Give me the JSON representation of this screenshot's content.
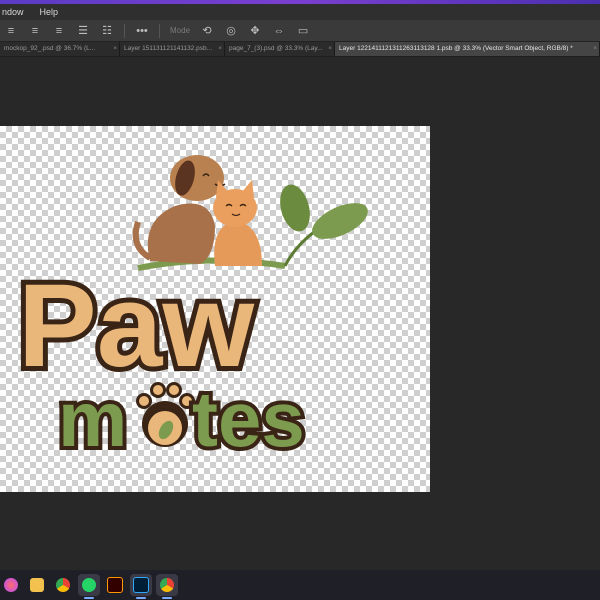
{
  "menu": {
    "items": [
      "ndow",
      "Help"
    ]
  },
  "options_bar": {
    "mode_label": "Mode"
  },
  "tabs": [
    {
      "label": "mockop_92_.psd @ 36.7% (L...",
      "active": false
    },
    {
      "label": "Layer 151131121141132.psb...",
      "active": false
    },
    {
      "label": "page_7_(3).psd @ 33.3% (Lay...",
      "active": false
    },
    {
      "label": "Layer 1221411121311263113128 1.psb @ 33.3% (Vector Smart Object, RGB/8) *",
      "active": true
    }
  ],
  "logo": {
    "word_top": "Paw",
    "word_bottom_start": "m",
    "word_bottom_end": "tes"
  },
  "colors": {
    "accent": "#5b3cc4",
    "brand_orange": "#eab77a",
    "brand_green": "#7d9b4e",
    "brand_dark": "#3a2415"
  },
  "taskbar": {
    "icons": [
      "start-icon",
      "file-explorer-icon",
      "chrome-icon",
      "whatsapp-icon",
      "illustrator-icon",
      "photoshop-icon",
      "chrome-icon"
    ]
  }
}
